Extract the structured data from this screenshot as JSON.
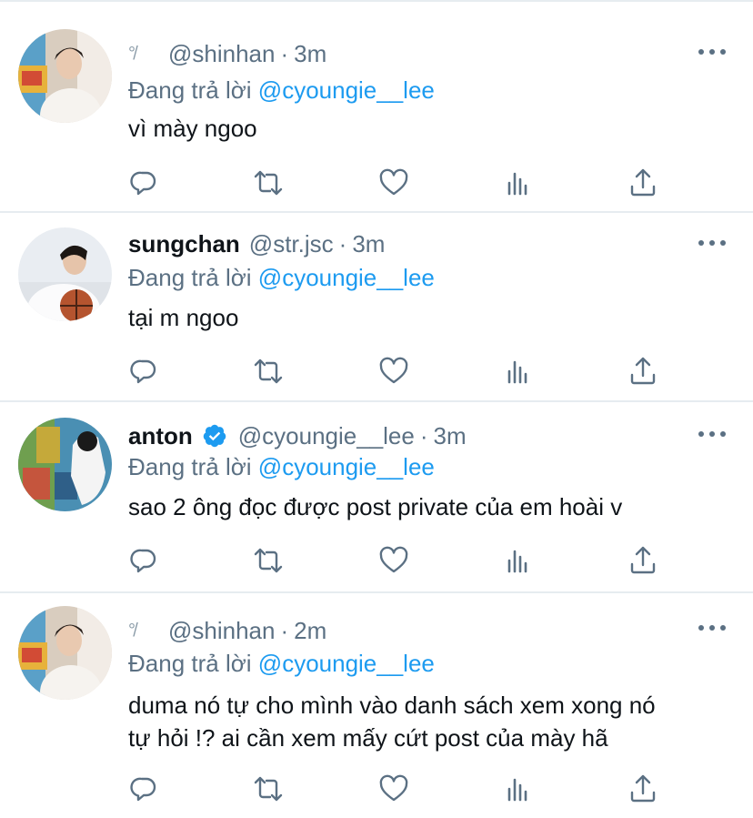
{
  "tweets": [
    {
      "name": "",
      "glyph": "°̸",
      "handle": "@shinhan",
      "time": "3m",
      "reply_prefix": "Đang trả lời",
      "reply_to": "@cyoungie__lee",
      "text": "vì mày ngoo",
      "avatar": "avatar-shinhan"
    },
    {
      "name": "sungchan",
      "handle": "@str.jsc",
      "time": "3m",
      "reply_prefix": "Đang trả lời",
      "reply_to": "@cyoungie__lee",
      "text": "tại m ngoo",
      "avatar": "avatar-sungchan"
    },
    {
      "name": "anton",
      "verified": true,
      "handle": "@cyoungie__lee",
      "time": "3m",
      "reply_prefix": "Đang trả lời",
      "reply_to": "@cyoungie__lee",
      "text": "sao 2 ông đọc được post private của em hoài v",
      "avatar": "avatar-anton"
    },
    {
      "name": "",
      "glyph": "°̸",
      "handle": "@shinhan",
      "time": "2m",
      "reply_prefix": "Đang trả lời",
      "reply_to": "@cyoungie__lee",
      "text_line1": "duma nó tự cho mình vào danh sách xem xong nó",
      "text_line2": "tự hỏi !? ai cần xem mấy cứt post của mày hã",
      "avatar": "avatar-shinhan"
    }
  ],
  "icons": {
    "reply": "reply-icon",
    "retweet": "retweet-icon",
    "like": "heart-icon",
    "analytics": "analytics-icon",
    "share": "share-icon",
    "more": "more-icon",
    "verified": "verified-badge-icon"
  },
  "colors": {
    "accent": "#1d9bf0",
    "muted": "#5b7083",
    "divider": "#e6ecf0"
  }
}
